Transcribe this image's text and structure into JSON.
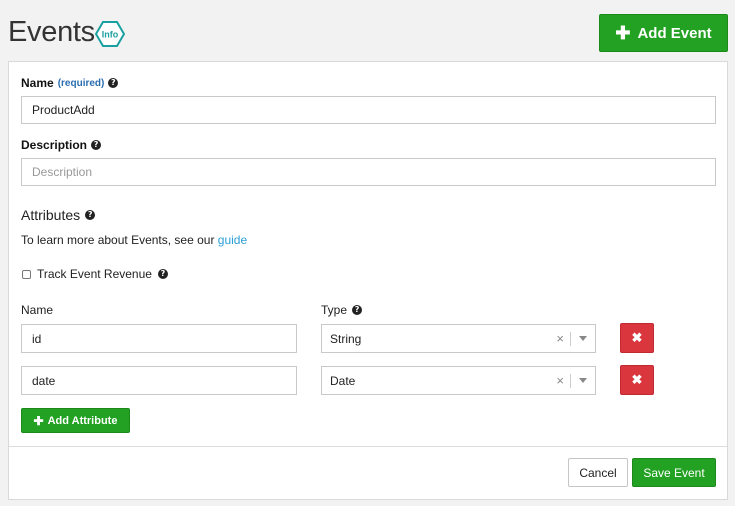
{
  "header": {
    "title": "Events",
    "info_badge_text": "Info",
    "add_event_label": "Add Event"
  },
  "form": {
    "name": {
      "label": "Name",
      "required_text": "(required)",
      "value": "ProductAdd"
    },
    "description": {
      "label": "Description",
      "placeholder": "Description",
      "value": ""
    },
    "attributes": {
      "title": "Attributes",
      "help_prefix": "To learn more about Events, see our ",
      "help_link": "guide",
      "track_revenue_label": "Track Event Revenue",
      "track_revenue_checked": false,
      "col_name": "Name",
      "col_type": "Type",
      "rows": [
        {
          "name": "id",
          "type": "String"
        },
        {
          "name": "date",
          "type": "Date"
        }
      ],
      "add_attribute_label": "Add Attribute"
    }
  },
  "footer": {
    "cancel_label": "Cancel",
    "save_label": "Save Event"
  },
  "colors": {
    "primary_green": "#22a122",
    "danger_red": "#d9363e",
    "link_blue": "#2a9fd6"
  }
}
